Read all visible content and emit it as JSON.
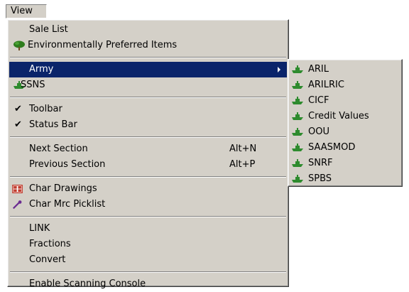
{
  "menubar": {
    "view_label": "View"
  },
  "view_menu": {
    "sale_list": "Sale List",
    "environmentally_preferred": "Environmentally Preferred Items",
    "army": "Army",
    "ssns": "SSNS",
    "toolbar": "Toolbar",
    "status_bar": "Status Bar",
    "next_section": "Next Section",
    "next_section_shortcut": "Alt+N",
    "previous_section": "Previous Section",
    "previous_section_shortcut": "Alt+P",
    "char_drawings": "Char Drawings",
    "char_mrc_picklist": "Char Mrc Picklist",
    "link": "LINK",
    "fractions": "Fractions",
    "convert": "Convert",
    "enable_scanning_console": "Enable Scanning Console",
    "check_glyph": "✔"
  },
  "army_submenu": {
    "items": [
      "ARIL",
      "ARILRIC",
      "CICF",
      "Credit Values",
      "OOU",
      "SAASMOD",
      "SNRF",
      "SPBS"
    ]
  },
  "colors": {
    "menu_bg": "#d4d0c8",
    "highlight_bg": "#0a246a",
    "highlight_text": "#ffffff",
    "icon_green": "#2e8b2e",
    "tree_green": "#2f7d1e",
    "drawing_red": "#c0392b",
    "picklist_purple": "#6b2c91"
  },
  "icons": {
    "tree": "tree-icon",
    "ship": "ship-icon",
    "drawing": "drawings-grid-icon",
    "picklist": "magic-wand-icon"
  }
}
